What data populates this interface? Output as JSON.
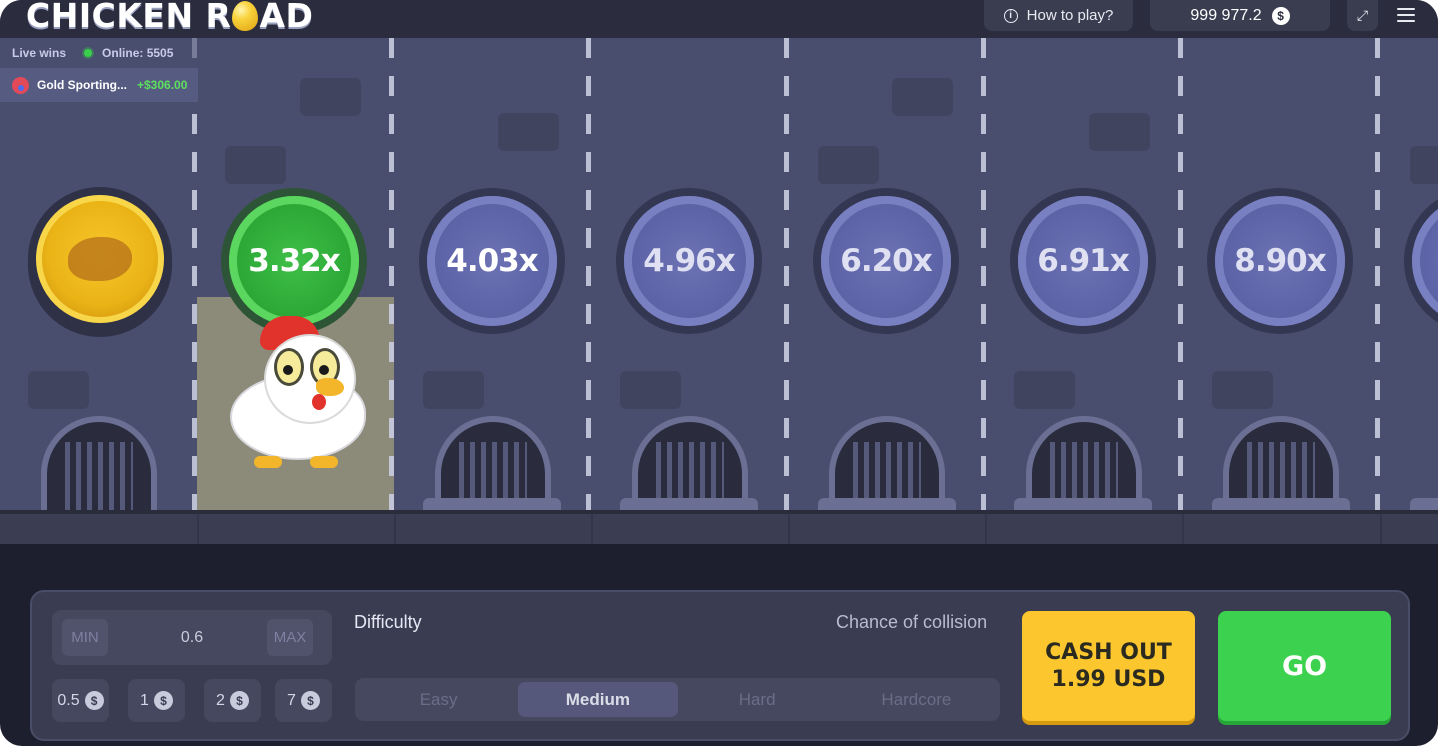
{
  "header": {
    "logo_left": "CHICKEN R",
    "logo_right": "AD",
    "how_to_play": "How to play?",
    "balance": "999 977.2",
    "currency_symbol": "$"
  },
  "live_wins": {
    "title": "Live wins",
    "online_label": "Online: 5505",
    "entries": [
      {
        "user": "Gold Sporting...",
        "amount": "+$306.00"
      }
    ]
  },
  "game": {
    "multipliers": [
      "3.32x",
      "4.03x",
      "4.96x",
      "6.20x",
      "6.91x",
      "8.90x"
    ],
    "active_multiplier": "3.32x"
  },
  "controls": {
    "bet": {
      "min_label": "MIN",
      "max_label": "MAX",
      "value": "0.6"
    },
    "quick_bets": [
      "0.5",
      "1",
      "2",
      "7"
    ],
    "difficulty_label": "Difficulty",
    "chance_label": "Chance of collision",
    "difficulty_options": [
      "Easy",
      "Medium",
      "Hard",
      "Hardcore"
    ],
    "selected_difficulty": "Medium",
    "cashout_line1": "CASH OUT",
    "cashout_line2": "1.99 USD",
    "go_label": "GO"
  },
  "colors": {
    "accent_green": "#3cd24f",
    "accent_yellow": "#fcc72e",
    "win_green": "#5ee05f"
  },
  "icons": {
    "info": "info-icon",
    "coin": "dollar-coin-icon",
    "fullscreen": "fullscreen-icon",
    "menu": "hamburger-menu-icon"
  }
}
